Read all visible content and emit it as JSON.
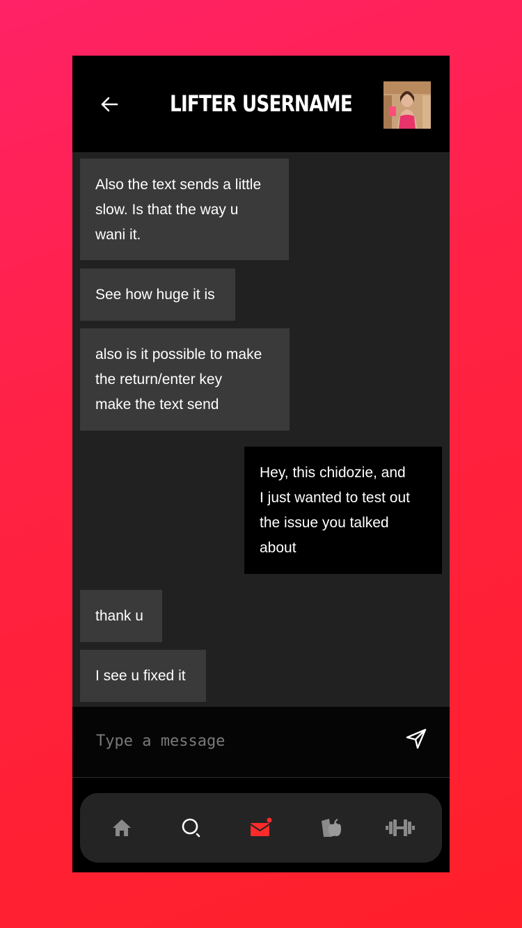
{
  "header": {
    "title": "LIFTER USERNAME",
    "back_icon": "arrow-left-icon",
    "avatar_alt": "Lifter avatar"
  },
  "messages": [
    {
      "direction": "incoming",
      "text": "Also the text sends a little\nslow. Is that the way u\nwani it."
    },
    {
      "direction": "incoming",
      "text": "See how huge it is"
    },
    {
      "direction": "incoming",
      "text": "also is it possible to make\nthe return/enter key\nmake the text send"
    },
    {
      "direction": "outgoing",
      "text": "Hey, this chidozie, and\nI just wanted to test out\nthe issue you talked\nabout"
    },
    {
      "direction": "incoming",
      "text": "thank u"
    },
    {
      "direction": "incoming",
      "text": "I see u fixed it"
    }
  ],
  "composer": {
    "placeholder": "Type a message",
    "value": "",
    "send_icon": "send-icon"
  },
  "nav": {
    "items": [
      {
        "name": "home",
        "icon": "home-icon",
        "active": false
      },
      {
        "name": "search",
        "icon": "search-icon",
        "active": false
      },
      {
        "name": "messages",
        "icon": "mail-icon",
        "active": true,
        "badge": true
      },
      {
        "name": "nutrition",
        "icon": "apple-icon",
        "active": false
      },
      {
        "name": "workouts",
        "icon": "dumbbell-icon",
        "active": false
      }
    ]
  },
  "colors": {
    "accent": "#ff2a2a",
    "inactive_icon": "#8a8a8a",
    "incoming_bubble": "#3a3a3a",
    "outgoing_bubble": "#000000",
    "chat_background": "#212121"
  }
}
